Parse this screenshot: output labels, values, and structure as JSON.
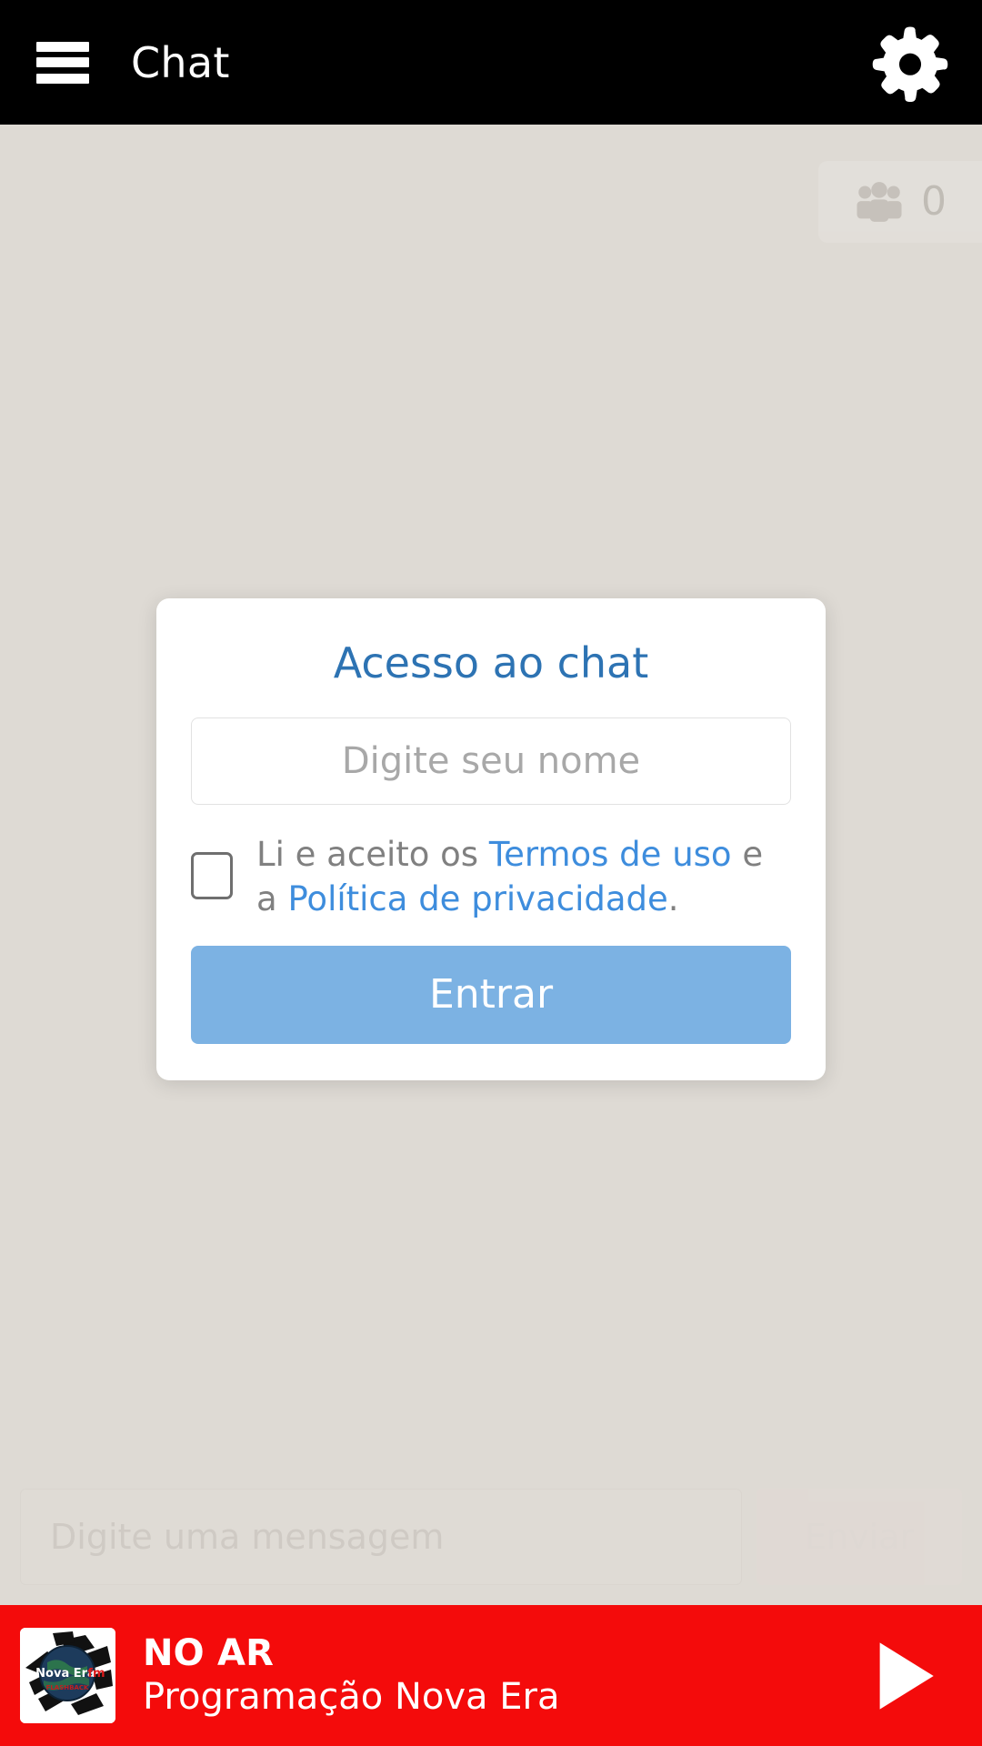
{
  "header": {
    "title": "Chat",
    "menu_icon": "hamburger-menu-icon",
    "settings_icon": "gear-icon"
  },
  "chat": {
    "participants_icon": "people-icon",
    "participants_count": "0",
    "composer": {
      "placeholder": "Digite uma mensagem",
      "send_label": "Enviar"
    }
  },
  "modal": {
    "title": "Acesso ao chat",
    "name_placeholder": "Digite seu nome",
    "name_value": "",
    "terms": {
      "prefix": "Li e aceito os ",
      "terms_link": "Termos de uso",
      "middle": " e a ",
      "privacy_link": "Política de privacidade",
      "suffix": "."
    },
    "checkbox_checked": false,
    "submit_label": "Entrar"
  },
  "player": {
    "status": "NO AR",
    "program": "Programação Nova Era",
    "play_icon": "play-icon",
    "artwork": {
      "station_name": "Nova Era",
      "station_suffix": "fm",
      "tagline": "FLASHBACK"
    }
  },
  "colors": {
    "header_bg": "#000000",
    "page_bg": "#dedad4",
    "modal_title": "#2d73b3",
    "link": "#3e8ddd",
    "primary_button": "#7cb2e3",
    "player_bg": "#f40b0b"
  }
}
